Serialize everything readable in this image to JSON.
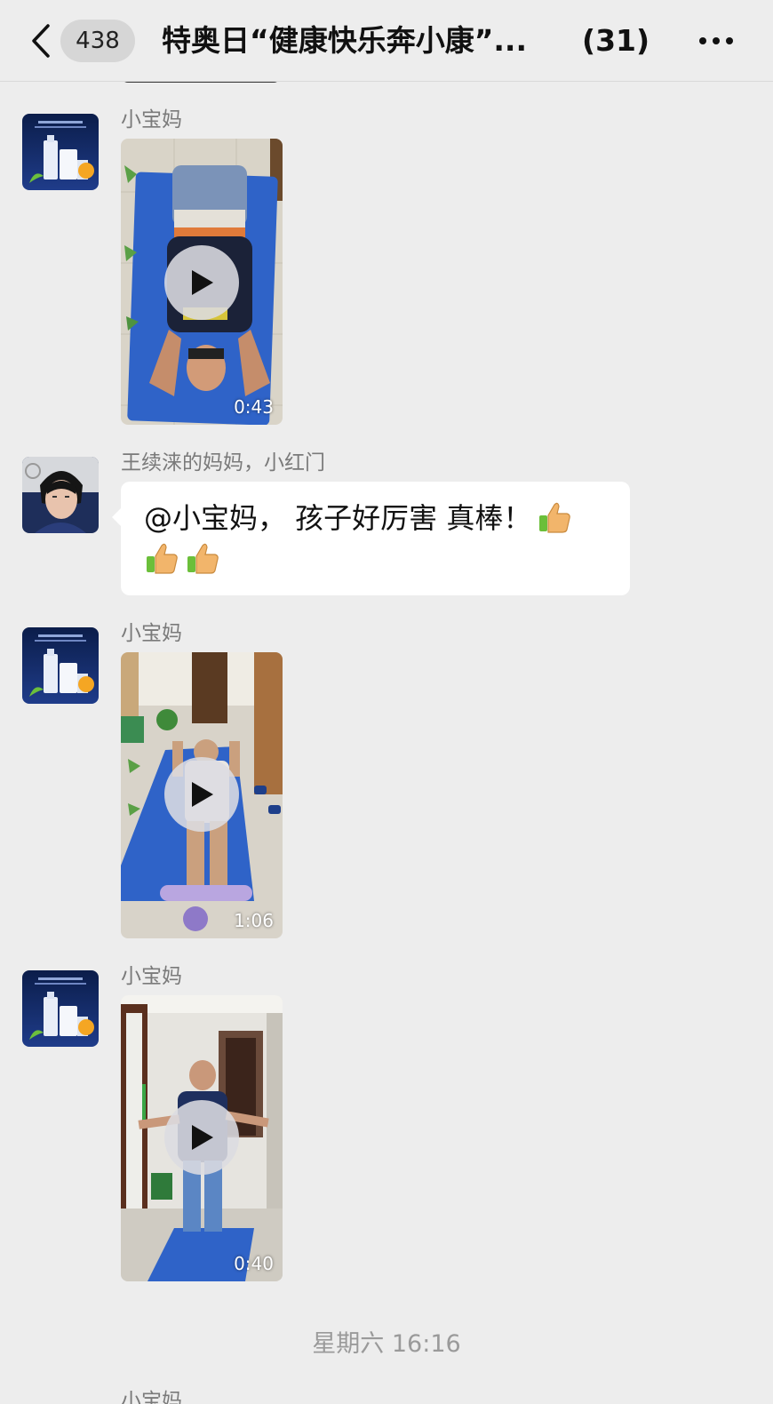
{
  "header": {
    "unread_count": "438",
    "title": "特奥日“健康快乐奔小康”...",
    "member_count": "(31)"
  },
  "messages": [
    {
      "sender": "小宝妈",
      "type": "video",
      "duration": "0:43"
    },
    {
      "sender": "王续涞的妈妈，小红门",
      "type": "text",
      "text": "@小宝妈， 孩子好厉害 真棒！"
    },
    {
      "sender": "小宝妈",
      "type": "video",
      "duration": "1:06"
    },
    {
      "sender": "小宝妈",
      "type": "video",
      "duration": "0:40"
    }
  ],
  "timestamp": "星期六 16:16",
  "partial_sender": "小宝妈",
  "colors": {
    "background": "#ededed",
    "bubble": "#ffffff",
    "sender_text": "#7a7a7a",
    "mat_blue": "#2f63c8"
  },
  "icons": [
    "chevron-left-icon",
    "more-icon",
    "play-icon",
    "thumbs-up-icon"
  ]
}
